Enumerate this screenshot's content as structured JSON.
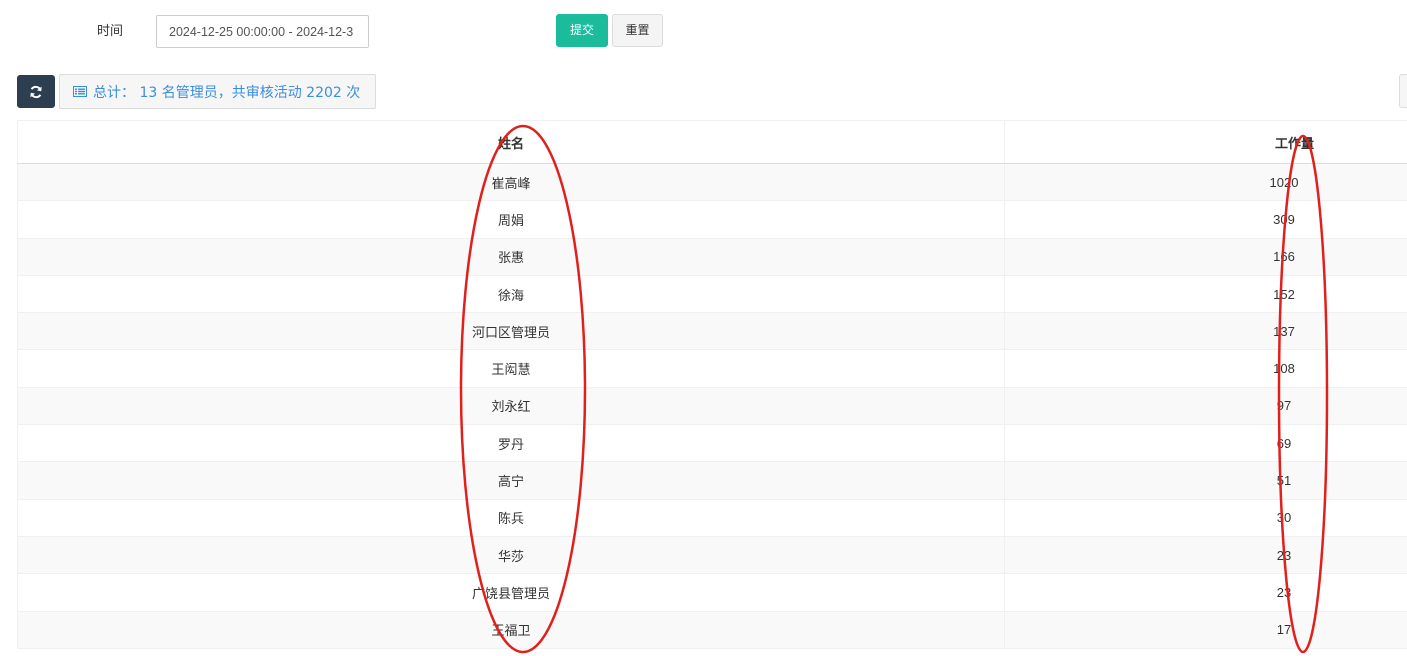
{
  "filter": {
    "time_label": "时间",
    "time_value": "2024-12-25 00:00:00 - 2024-12-3",
    "submit_label": "提交",
    "reset_label": "重置"
  },
  "toolbar": {
    "refresh_icon": "refresh-icon",
    "summary_icon": "list-alt-icon",
    "summary_text": "总计： 13 名管理员，共审核活动 2202 次"
  },
  "table": {
    "columns": [
      "姓名",
      "工作量"
    ],
    "rows": [
      {
        "name": "崔高峰",
        "workload": "1020"
      },
      {
        "name": "周娟",
        "workload": "309"
      },
      {
        "name": "张惠",
        "workload": "166"
      },
      {
        "name": "徐海",
        "workload": "152"
      },
      {
        "name": "河口区管理员",
        "workload": "137"
      },
      {
        "name": "王闳慧",
        "workload": "108"
      },
      {
        "name": "刘永红",
        "workload": "97"
      },
      {
        "name": "罗丹",
        "workload": "69"
      },
      {
        "name": "高宁",
        "workload": "51"
      },
      {
        "name": "陈兵",
        "workload": "30"
      },
      {
        "name": "华莎",
        "workload": "23"
      },
      {
        "name": "广饶县管理员",
        "workload": "23"
      },
      {
        "name": "王福卫",
        "workload": "17"
      }
    ]
  },
  "colors": {
    "submit": "#1abc9c",
    "refresh": "#2c3e50",
    "summary_text": "#3c8dde",
    "annotation": "#e0201c"
  }
}
